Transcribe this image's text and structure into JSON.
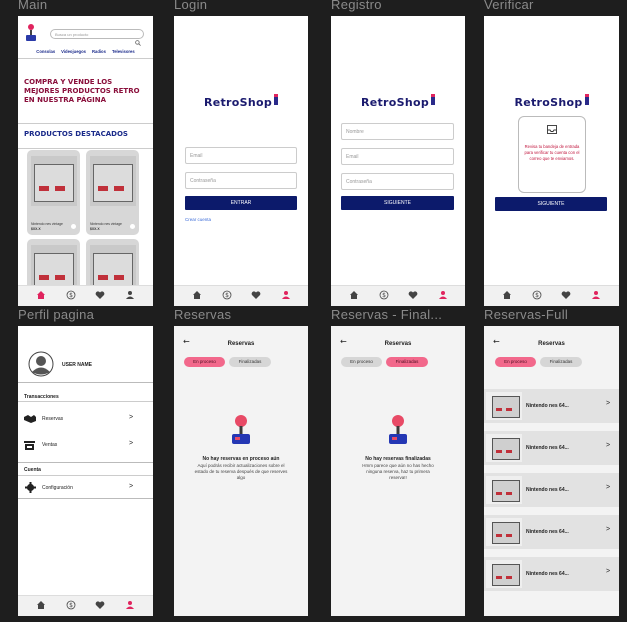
{
  "frames": {
    "main": {
      "title": "Main",
      "search_placeholder": "Busca un producto",
      "categories": [
        "Consolas",
        "Videojuegos",
        "Radios",
        "Televisores"
      ],
      "hero": "COMPRA Y VENDE LOS MEJORES PRODUCTOS RETRO EN NUESTRA PÁGINA",
      "featured_title": "PRODUCTOS DESTACADOS",
      "products": [
        {
          "name": "Nintendo nes vintage",
          "price": "$XX.X"
        },
        {
          "name": "Nintendo nes vintage",
          "price": "$XX.X"
        }
      ]
    },
    "login": {
      "title": "Login",
      "logo": "RetroShop",
      "email_placeholder": "Email",
      "password_placeholder": "Contraseña",
      "button": "ENTRAR",
      "create_account": "Crear cuenta"
    },
    "registro": {
      "title": "Registro",
      "logo": "RetroShop",
      "name_placeholder": "Nombre",
      "email_placeholder": "Email",
      "password_placeholder": "Contraseña",
      "button": "SIGUIENTE"
    },
    "verificar": {
      "title": "Verificar",
      "logo": "RetroShop",
      "message": "Revisa tu bandeja de entrada para verificar tu cuenta con el correo que te enviamos.",
      "button": "SIGUIENTE"
    },
    "perfil": {
      "title": "Perfil pagina",
      "username": "USER NAME",
      "section_transacciones": "Transacciones",
      "item_reservas": "Reservas",
      "item_ventas": "Ventas",
      "section_cuenta": "Cuenta",
      "item_config": "Configuración",
      "chevron": ">"
    },
    "reservas": {
      "title": "Reservas",
      "header": "Reservas",
      "tab_active": "En proceso",
      "tab_inactive": "Finalizadas",
      "empty_title": "No hay reservas en proceso aún",
      "empty_body": "Aquí podrás recibir actualizaciones sobre el estado de tu reserva después de que reserves algo"
    },
    "reservas_final": {
      "title": "Reservas - Final...",
      "header": "Reservas",
      "tab_inactive": "En proceso",
      "tab_active": "Finalizadas",
      "empty_title": "No hay reservas finalizadas",
      "empty_body": "Hmm parece que aún no has hecho ninguna reserva, haz tu primera reserva!!"
    },
    "reservas_full": {
      "title": "Reservas-Full",
      "header": "Reservas",
      "tab_active": "En proceso",
      "tab_inactive": "Finalizadas",
      "items": [
        "Nintendo nes 64...",
        "Nintendo nes 64...",
        "Nintendo nes 64...",
        "Nintendo nes 64...",
        "Nintendo nes 64..."
      ],
      "chevron": ">"
    }
  },
  "icons": {
    "back": "←",
    "home": "home-icon",
    "dollar": "dollar-icon",
    "heart": "heart-icon",
    "user": "user-icon"
  },
  "colors": {
    "canvas": "#1e1e1e",
    "primary_navy": "#0c1a6b",
    "accent_pink": "#f2688b",
    "hero_crimson": "#8a0f3b"
  }
}
